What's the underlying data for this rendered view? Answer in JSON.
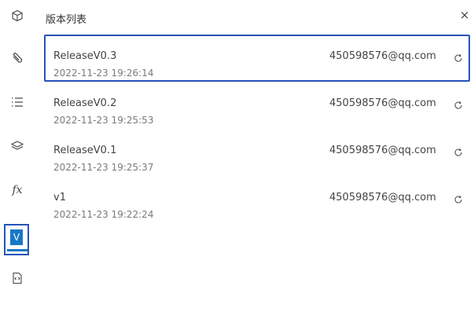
{
  "panel": {
    "title": "版本列表",
    "close_label": "×"
  },
  "sidebar": {
    "items": [
      {
        "name": "cube-icon"
      },
      {
        "name": "paperclip-icon"
      },
      {
        "name": "list-icon"
      },
      {
        "name": "layers-icon"
      },
      {
        "name": "function-icon",
        "label": "fx"
      },
      {
        "name": "version-icon",
        "label": "V",
        "active": true
      },
      {
        "name": "code-file-icon"
      }
    ]
  },
  "versions": [
    {
      "name": "ReleaseV0.3",
      "time": "2022-11-23 19:26:14",
      "author": "450598576@qq.com",
      "selected": true
    },
    {
      "name": "ReleaseV0.2",
      "time": "2022-11-23 19:25:53",
      "author": "450598576@qq.com"
    },
    {
      "name": "ReleaseV0.1",
      "time": "2022-11-23 19:25:37",
      "author": "450598576@qq.com"
    },
    {
      "name": "v1",
      "time": "2022-11-23 19:22:24",
      "author": "450598576@qq.com"
    }
  ],
  "colors": {
    "accent_border": "#2553b9",
    "active_icon": "#1778c5"
  }
}
